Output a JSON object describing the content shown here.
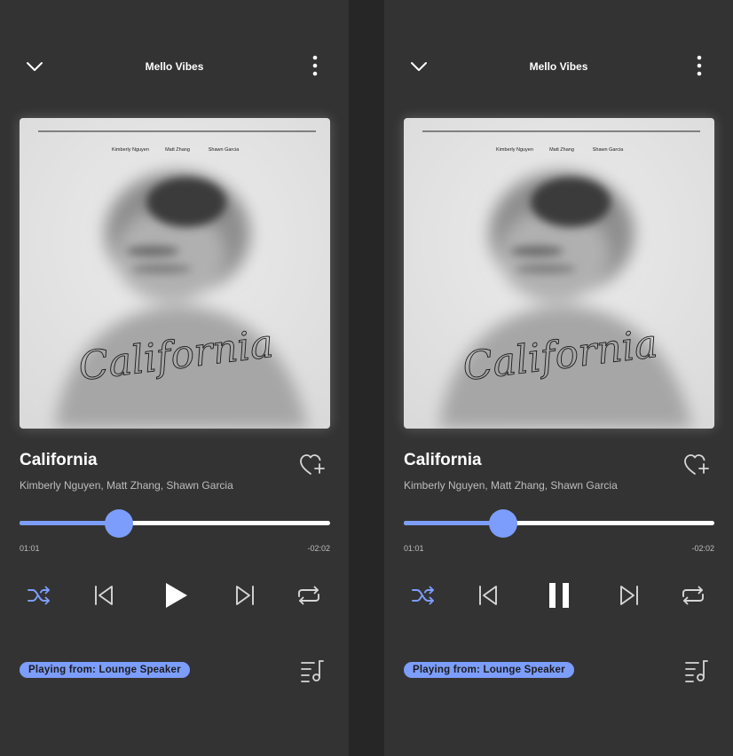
{
  "screens": [
    {
      "state": "paused",
      "header": {
        "title": "Mello Vibes"
      },
      "album_art": {
        "credits": [
          "Kimberly Nguyen",
          "Matt Zhang",
          "Shawn Garcia"
        ],
        "script_title": "California"
      },
      "track": {
        "title": "California",
        "artists": "Kimberly Nguyen, Matt Zhang, Shawn Garcia"
      },
      "progress": {
        "elapsed": "01:01",
        "remaining": "-02:02",
        "fraction": 0.32
      },
      "controls": {
        "shuffle_active": true,
        "play_pause": "play"
      },
      "source": {
        "label": "Playing from: Lounge Speaker"
      }
    },
    {
      "state": "playing",
      "header": {
        "title": "Mello Vibes"
      },
      "album_art": {
        "credits": [
          "Kimberly Nguyen",
          "Matt Zhang",
          "Shawn Garcia"
        ],
        "script_title": "California"
      },
      "track": {
        "title": "California",
        "artists": "Kimberly Nguyen, Matt Zhang, Shawn Garcia"
      },
      "progress": {
        "elapsed": "01:01",
        "remaining": "-02:02",
        "fraction": 0.32
      },
      "controls": {
        "shuffle_active": true,
        "play_pause": "pause"
      },
      "source": {
        "label": "Playing from: Lounge Speaker"
      }
    }
  ],
  "colors": {
    "accent": "#7c9dfb",
    "background": "#333333",
    "text_primary": "#ffffff",
    "text_secondary": "#bdbdbd"
  },
  "icons": {
    "collapse": "chevron-down-icon",
    "more": "more-vertical-icon",
    "favorite": "heart-add-icon",
    "shuffle": "shuffle-icon",
    "previous": "skip-previous-icon",
    "play": "play-icon",
    "pause": "pause-icon",
    "next": "skip-next-icon",
    "repeat": "repeat-icon",
    "queue": "queue-music-icon"
  }
}
